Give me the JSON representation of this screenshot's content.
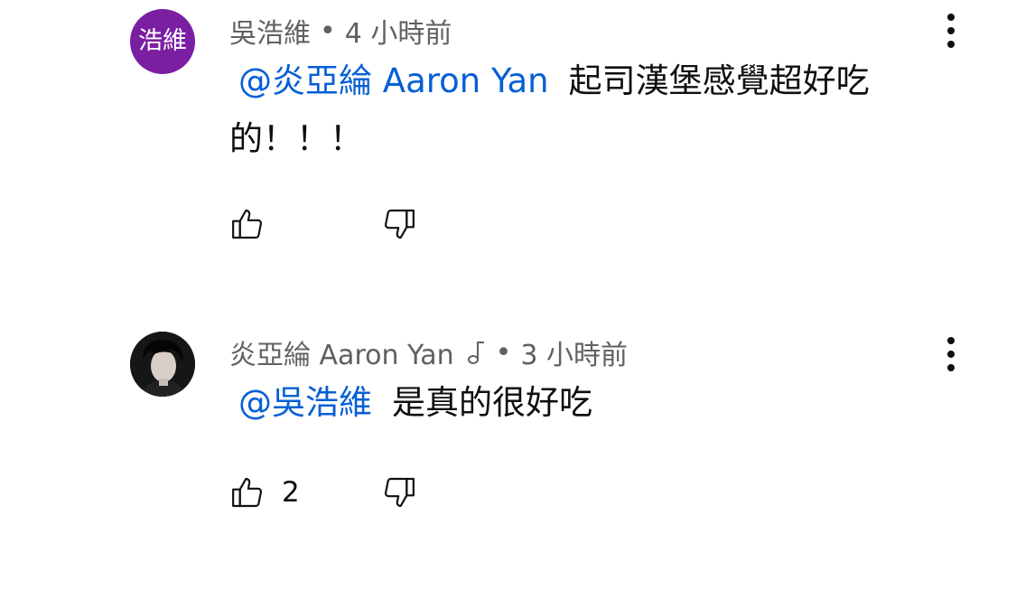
{
  "comments": [
    {
      "avatar_text": "浩維",
      "author": "吳浩維",
      "separator": "•",
      "time": "4 小時前",
      "mention": "@炎亞綸 Aaron Yan",
      "text": "起司漢堡感覺超好吃的！！！",
      "likes": ""
    },
    {
      "author": "炎亞綸 Aaron Yan",
      "separator": "•",
      "time": "3 小時前",
      "mention": "@吳浩維",
      "text": "是真的很好吃",
      "likes": "2"
    }
  ],
  "icons": {
    "like": "thumbs-up-icon",
    "dislike": "thumbs-down-icon",
    "more": "more-vert-icon",
    "music": "music-note-icon"
  },
  "colors": {
    "mention": "#065fd4",
    "meta": "#606060",
    "avatar_bg": "#7b1fa2"
  }
}
